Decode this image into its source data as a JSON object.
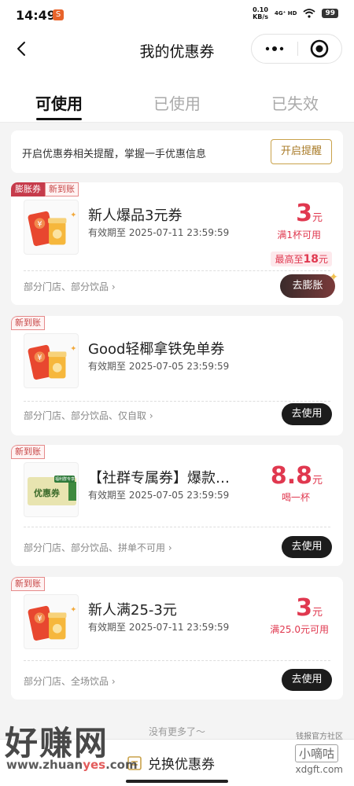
{
  "status_bar": {
    "time": "14:49",
    "app_badge": "S",
    "net_speed_value": "0.10",
    "net_speed_unit": "KB/s",
    "network": "4G⁺ HD",
    "battery": "99"
  },
  "nav": {
    "title": "我的优惠券",
    "icons": [
      "back-icon",
      "more-dots-icon",
      "close-target-icon"
    ]
  },
  "tabs": [
    {
      "label": "可使用",
      "active": true
    },
    {
      "label": "已使用",
      "active": false
    },
    {
      "label": "已失效",
      "active": false
    }
  ],
  "notice": {
    "text": "开启优惠券相关提醒，掌握一手优惠信息",
    "button": "开启提醒"
  },
  "coupons": [
    {
      "badges": [
        "膨胀券",
        "新到账"
      ],
      "title": "新人爆品3元券",
      "validity": "有效期至 2025-07-11 23:59:59",
      "amount": "3",
      "unit": "元",
      "condition": "满1杯可用",
      "max_tag_prefix": "最高至",
      "max_tag_value": "18",
      "max_tag_unit": "元",
      "scope": "部分门店、部分饮品 ›",
      "action": "去膨胀",
      "thumb": "red-envelope-drink"
    },
    {
      "badges": [
        "新到账"
      ],
      "title": "Good轻椰拿铁免单券",
      "validity": "有效期至 2025-07-05 23:59:59",
      "scope": "部分门店、部分饮品、仅自取 ›",
      "action": "去使用",
      "thumb": "red-envelope-drink"
    },
    {
      "badges": [
        "新到账"
      ],
      "title": "【社群专属券】爆款…",
      "validity": "有效期至 2025-07-05 23:59:59",
      "amount": "8.8",
      "unit": "元",
      "condition": "喝一杯",
      "scope": "部分门店、部分饮品、拼单不可用 ›",
      "action": "去使用",
      "thumb_label": "优惠券",
      "thumb_tag": "福利群专享"
    },
    {
      "badges": [
        "新到账"
      ],
      "title": "新人满25-3元",
      "validity": "有效期至 2025-07-11 23:59:59",
      "amount": "3",
      "unit": "元",
      "condition": "满25.0元可用",
      "scope": "部分门店、全场饮品 ›",
      "action": "去使用",
      "thumb": "red-envelope-drink"
    }
  ],
  "footer": {
    "no_more": "没有更多了～",
    "exchange_label": "兑换优惠券"
  },
  "watermark": {
    "big": "好赚网",
    "url_pre": "www.zhuan",
    "url_hl": "yes",
    "url_post": ".com",
    "right_top": "钱报官方社区",
    "right_mid": "小嘀咕",
    "right_bot": "xdgft.com"
  },
  "colors": {
    "accent_red": "#e0384f",
    "gold_border": "#c9a24a",
    "dark_button": "#1c1c1c"
  }
}
